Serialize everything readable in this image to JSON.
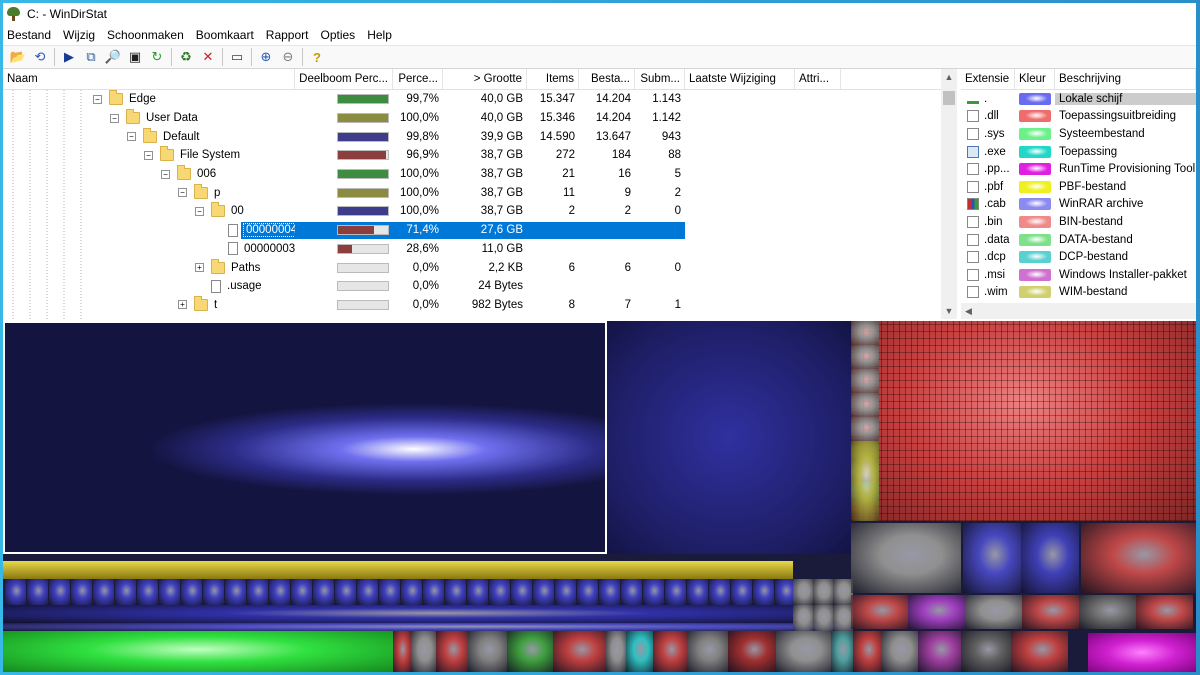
{
  "window": {
    "title": "C: - WinDirStat"
  },
  "menu": [
    "Bestand",
    "Wijzig",
    "Schoonmaken",
    "Boomkaart",
    "Rapport",
    "Opties",
    "Help"
  ],
  "toolbar": [
    {
      "name": "open-icon",
      "glyph": "📂"
    },
    {
      "name": "refresh-icon",
      "glyph": "⟲"
    },
    {
      "name": "play-icon",
      "glyph": "▶"
    },
    {
      "name": "copy-icon",
      "glyph": "⧉"
    },
    {
      "name": "explorer-icon",
      "glyph": "🔎"
    },
    {
      "name": "cmd-icon",
      "glyph": "▣"
    },
    {
      "name": "reload-icon",
      "glyph": "↻"
    },
    {
      "name": "recycle-icon",
      "glyph": "♻"
    },
    {
      "name": "delete-icon",
      "glyph": "✕"
    },
    {
      "name": "folder-icon",
      "glyph": "▭"
    },
    {
      "name": "zoom-in-icon",
      "glyph": "⊕"
    },
    {
      "name": "zoom-out-icon",
      "glyph": "⊖"
    },
    {
      "name": "help-icon",
      "glyph": "?"
    }
  ],
  "tree": {
    "columns": [
      "Naam",
      "Deelboom Perc...",
      "Perce...",
      "> Grootte",
      "Items",
      "Besta...",
      "Subm...",
      "Laatste Wijziging",
      "Attri..."
    ],
    "rows": [
      {
        "name": "Edge",
        "level": 0,
        "type": "folder",
        "exp": "−",
        "bar_color": "#3d8c40",
        "bar": 0.997,
        "pct": "99,7%",
        "size": "40,0 GB",
        "items": "15.347",
        "files": "14.204",
        "subs": "1.143"
      },
      {
        "name": "User Data",
        "level": 1,
        "type": "folder",
        "exp": "−",
        "bar_color": "#8c8c40",
        "bar": 1.0,
        "pct": "100,0%",
        "size": "40,0 GB",
        "items": "15.346",
        "files": "14.204",
        "subs": "1.142"
      },
      {
        "name": "Default",
        "level": 2,
        "type": "folder",
        "exp": "−",
        "bar_color": "#3d3d8c",
        "bar": 0.998,
        "pct": "99,8%",
        "size": "39,9 GB",
        "items": "14.590",
        "files": "13.647",
        "subs": "943"
      },
      {
        "name": "File System",
        "level": 3,
        "type": "folder",
        "exp": "−",
        "bar_color": "#8c3d3d",
        "bar": 0.969,
        "pct": "96,9%",
        "size": "38,7 GB",
        "items": "272",
        "files": "184",
        "subs": "88"
      },
      {
        "name": "006",
        "level": 4,
        "type": "folder",
        "exp": "−",
        "bar_color": "#3d8c40",
        "bar": 1.0,
        "pct": "100,0%",
        "size": "38,7 GB",
        "items": "21",
        "files": "16",
        "subs": "5"
      },
      {
        "name": "p",
        "level": 5,
        "type": "folder",
        "exp": "−",
        "bar_color": "#8c8c40",
        "bar": 1.0,
        "pct": "100,0%",
        "size": "38,7 GB",
        "items": "11",
        "files": "9",
        "subs": "2"
      },
      {
        "name": "00",
        "level": 6,
        "type": "folder",
        "exp": "−",
        "bar_color": "#3d3d8c",
        "bar": 1.0,
        "pct": "100,0%",
        "size": "38,7 GB",
        "items": "2",
        "files": "2",
        "subs": "0"
      },
      {
        "name": "00000004",
        "level": 7,
        "type": "file",
        "exp": "",
        "bar_color": "#8c3d3d",
        "bar": 0.714,
        "pct": "71,4%",
        "size": "27,6 GB",
        "items": "",
        "files": "",
        "subs": "",
        "selected": true
      },
      {
        "name": "00000003",
        "level": 7,
        "type": "file",
        "exp": "",
        "bar_color": "#8c3d3d",
        "bar": 0.286,
        "pct": "28,6%",
        "size": "11,0 GB",
        "items": "",
        "files": "",
        "subs": ""
      },
      {
        "name": "Paths",
        "level": 6,
        "type": "folder",
        "exp": "+",
        "bar_color": "#3d8c40",
        "bar": 0.0,
        "pct": "0,0%",
        "size": "2,2 KB",
        "items": "6",
        "files": "6",
        "subs": "0"
      },
      {
        "name": ".usage",
        "level": 6,
        "type": "file",
        "exp": "",
        "bar_color": "#3d8c40",
        "bar": 0.0,
        "pct": "0,0%",
        "size": "24 Bytes",
        "items": "",
        "files": "",
        "subs": ""
      },
      {
        "name": "t",
        "level": 5,
        "type": "folder",
        "exp": "+",
        "bar_color": "#3d8c40",
        "bar": 0.0,
        "pct": "0,0%",
        "size": "982 Bytes",
        "items": "8",
        "files": "7",
        "subs": "1"
      }
    ]
  },
  "extensions": {
    "columns": [
      "Extensie",
      "Kleur",
      "Beschrijving"
    ],
    "rows": [
      {
        "ext": ".",
        "color": "#6b6bf0",
        "desc": "Lokale schijf",
        "selected": true
      },
      {
        "ext": ".dll",
        "color": "#f06b6b",
        "desc": "Toepassingsuitbreiding"
      },
      {
        "ext": ".sys",
        "color": "#6bf08a",
        "desc": "Systeembestand"
      },
      {
        "ext": ".exe",
        "color": "#1fd8c8",
        "desc": "Toepassing"
      },
      {
        "ext": ".pp...",
        "color": "#e020e0",
        "desc": "RunTime Provisioning Tool"
      },
      {
        "ext": ".pbf",
        "color": "#f0f020",
        "desc": "PBF-bestand"
      },
      {
        "ext": ".cab",
        "color": "#8a8af0",
        "desc": "WinRAR archive"
      },
      {
        "ext": ".bin",
        "color": "#f08a8a",
        "desc": "BIN-bestand"
      },
      {
        "ext": ".data",
        "color": "#7ee08a",
        "desc": "DATA-bestand"
      },
      {
        "ext": ".dcp",
        "color": "#5ad0d0",
        "desc": "DCP-bestand"
      },
      {
        "ext": ".msi",
        "color": "#d070d0",
        "desc": "Windows Installer-pakket"
      },
      {
        "ext": ".wim",
        "color": "#d0d070",
        "desc": "WIM-bestand"
      }
    ]
  }
}
